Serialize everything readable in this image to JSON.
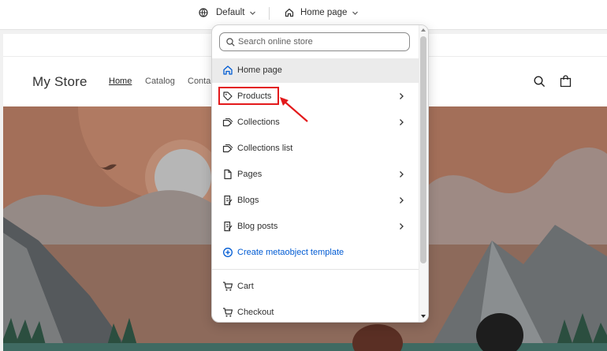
{
  "toolbar": {
    "theme_label": "Default",
    "page_label": "Home page"
  },
  "store": {
    "name": "My Store",
    "nav": [
      "Home",
      "Catalog",
      "Conta"
    ]
  },
  "dropdown": {
    "search_placeholder": "Search online store",
    "items": [
      {
        "label": "Home page",
        "icon": "home-icon",
        "selected": true,
        "chevron": false
      },
      {
        "label": "Products",
        "icon": "tag-icon",
        "selected": false,
        "chevron": true
      },
      {
        "label": "Collections",
        "icon": "tags-icon",
        "selected": false,
        "chevron": true
      },
      {
        "label": "Collections list",
        "icon": "tags-icon",
        "selected": false,
        "chevron": false
      },
      {
        "label": "Pages",
        "icon": "page-icon",
        "selected": false,
        "chevron": true
      },
      {
        "label": "Blogs",
        "icon": "blog-icon",
        "selected": false,
        "chevron": true
      },
      {
        "label": "Blog posts",
        "icon": "blog-icon",
        "selected": false,
        "chevron": true
      },
      {
        "label": "Create metaobject template",
        "icon": "plus-circle-icon",
        "selected": false,
        "chevron": false
      },
      {
        "label": "Cart",
        "icon": "cart-icon",
        "selected": false,
        "chevron": false
      },
      {
        "label": "Checkout",
        "icon": "cart-icon",
        "selected": false,
        "chevron": false
      }
    ]
  },
  "colors": {
    "highlight": "#e3191b",
    "link": "#005bd3",
    "hero_sky": "#a06c57"
  }
}
